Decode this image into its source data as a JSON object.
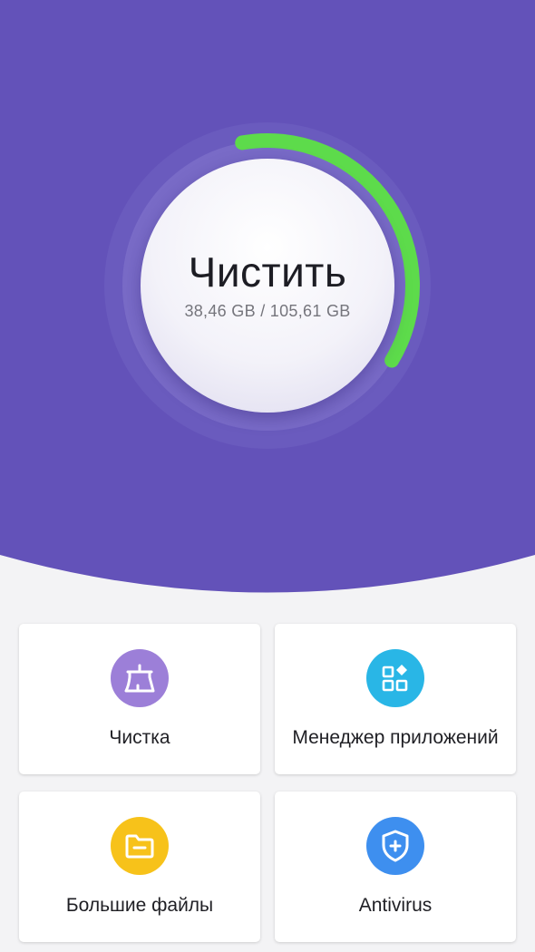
{
  "colors": {
    "header_background": "#6352b9",
    "progress_green": "#5ddb4b",
    "page_background": "#f3f3f5"
  },
  "main": {
    "button_label": "Чистить",
    "storage_text": "38,46 GB / 105,61 GB",
    "storage_used_fraction": 0.364
  },
  "features": [
    {
      "label": "Чистка",
      "icon": "broom-icon",
      "color": "#9c7fd8"
    },
    {
      "label": "Менеджер приложений",
      "icon": "apps-icon",
      "color": "#29b6e6"
    },
    {
      "label": "Большие файлы",
      "icon": "folder-icon",
      "color": "#f7c21a"
    },
    {
      "label": "Antivirus",
      "icon": "shield-icon",
      "color": "#3e8fef"
    }
  ]
}
